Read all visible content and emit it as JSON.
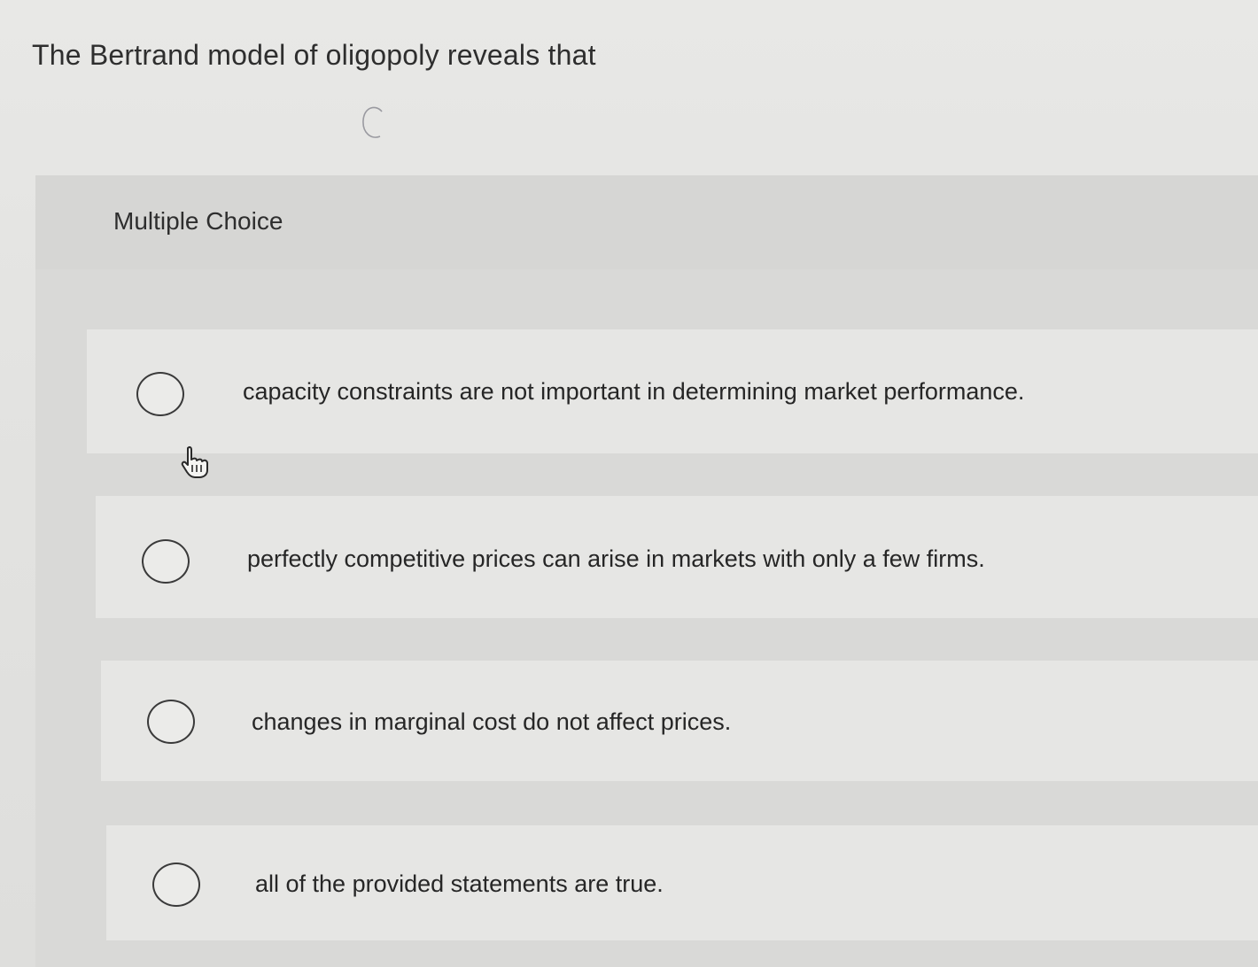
{
  "question": {
    "text": "The Bertrand model of oligopoly reveals that"
  },
  "section": {
    "label": "Multiple Choice"
  },
  "options": [
    {
      "label": "capacity constraints are not important in determining market performance.",
      "selected": false
    },
    {
      "label": "perfectly competitive prices can arise in markets with only a few firms.",
      "selected": false
    },
    {
      "label": "changes in marginal cost do not affect prices.",
      "selected": false
    },
    {
      "label": "all of the provided statements are true.",
      "selected": false
    }
  ],
  "icons": {
    "loading": "loading-spinner-icon",
    "cursor": "hand-pointer-icon",
    "radio": "radio-button-icon"
  },
  "colors": {
    "background": "#e4e4e2",
    "panel": "#d9d9d7",
    "option_bg": "#e6e6e4",
    "text": "#2b2b2b"
  }
}
